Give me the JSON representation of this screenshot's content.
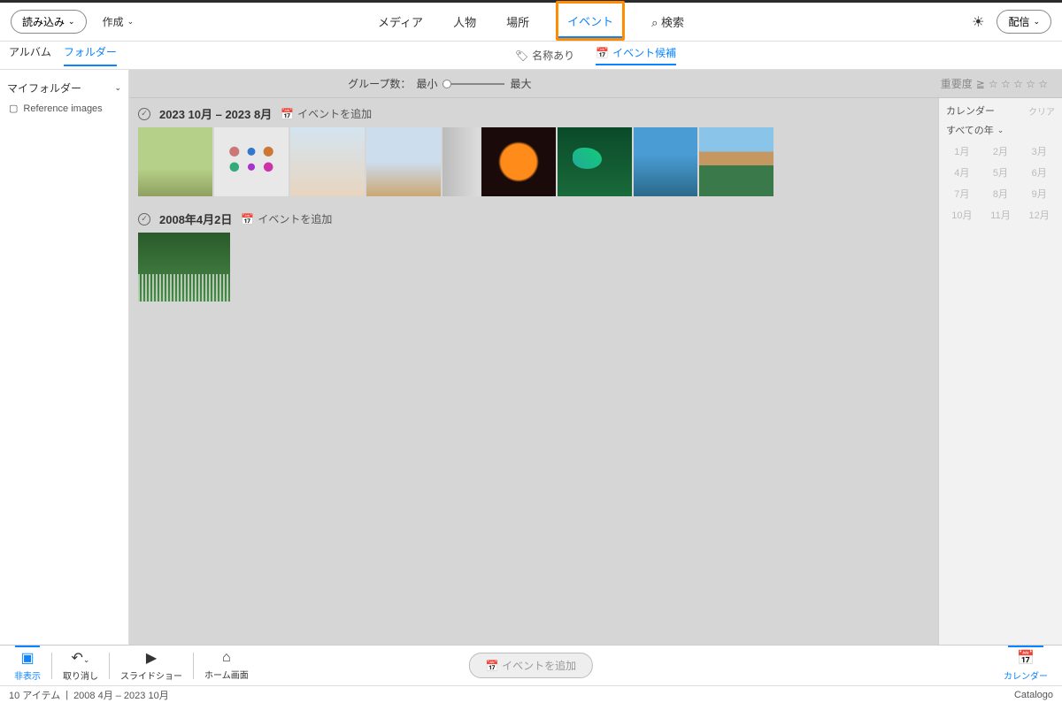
{
  "header": {
    "import_label": "読み込み",
    "create_label": "作成",
    "tabs": {
      "media": "メディア",
      "people": "人物",
      "place": "場所",
      "event": "イベント",
      "search": "検索"
    },
    "share_label": "配信"
  },
  "subheader": {
    "left_tabs": {
      "album": "アルバム",
      "folder": "フォルダー"
    },
    "named": "名称あり",
    "candidate": "イベント候補"
  },
  "sidebar_left": {
    "my_folder": "マイフォルダー",
    "ref_images": "Reference images"
  },
  "filter": {
    "group_label": "グループ数：",
    "min": "最小",
    "max": "最大",
    "importance": "重要度",
    "gte": "≧",
    "stars": "☆ ☆ ☆ ☆ ☆"
  },
  "events": [
    {
      "title": "2023 10月 – 2023 8月",
      "add": "イベントを追加"
    },
    {
      "title": "2008年4月2日",
      "add": "イベントを追加"
    }
  ],
  "calendar": {
    "title": "カレンダー",
    "clear": "クリア",
    "all_years": "すべての年",
    "months": [
      "1月",
      "2月",
      "3月",
      "4月",
      "5月",
      "6月",
      "7月",
      "8月",
      "9月",
      "10月",
      "11月",
      "12月"
    ]
  },
  "bottom": {
    "hide": "非表示",
    "undo": "取り消し",
    "slideshow": "スライドショー",
    "home": "ホーム画面",
    "add_event": "イベントを追加",
    "calendar": "カレンダー"
  },
  "status": {
    "items": "10 アイテム",
    "range": "2008 4月 – 2023 10月",
    "catalog": "Catalogo"
  }
}
